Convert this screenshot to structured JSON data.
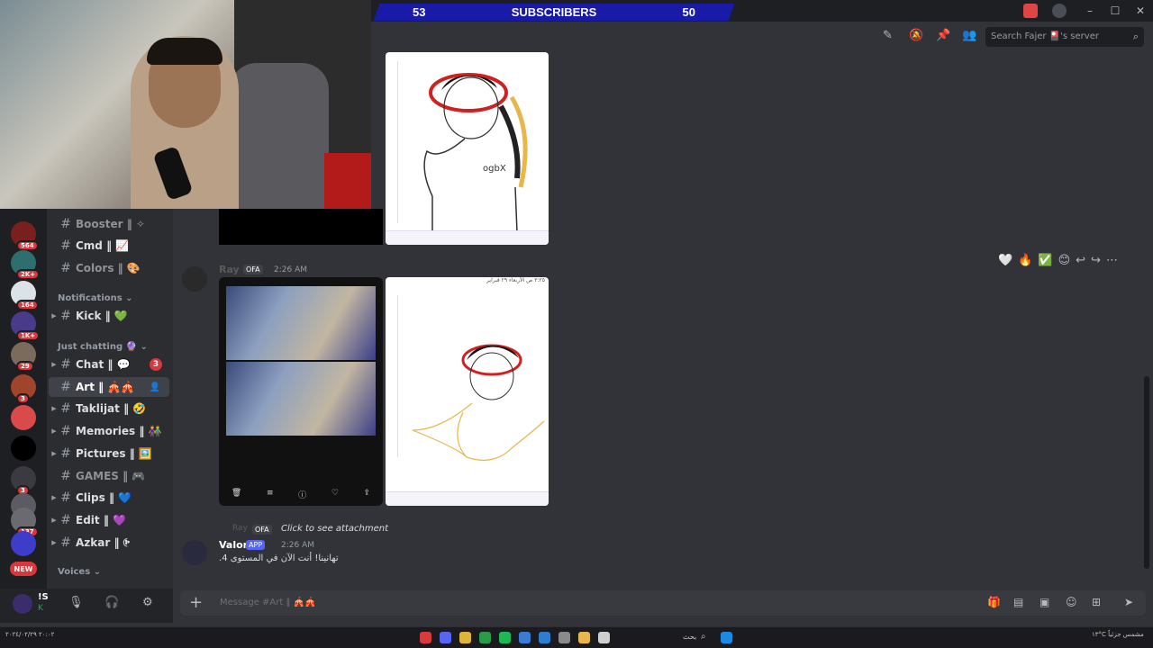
{
  "window": {
    "controls": [
      "–",
      "☐",
      "✕"
    ]
  },
  "subscribers": {
    "current": "53",
    "label": "SUBSCRIBERS",
    "goal": "50"
  },
  "servers": [
    {
      "label": "564",
      "color": "#7a1f1f"
    },
    {
      "label": "2K+",
      "color": "#2f6e6e"
    },
    {
      "label": "164",
      "color": "#dce3e8"
    },
    {
      "label": "1K+",
      "color": "#4a3a8a"
    },
    {
      "label": "29",
      "color": "#7a6b5c"
    },
    {
      "label": "3",
      "color": "#a0442c"
    },
    {
      "label": "",
      "color": "#d94a4a"
    },
    {
      "label": "",
      "color": "#000000"
    },
    {
      "label": "3",
      "color": "#3a3a40"
    },
    {
      "label": "3",
      "color": "#5b5b64"
    },
    {
      "label": "137",
      "color": "#6a6a70"
    },
    {
      "label": "",
      "color": "#3d3dc9"
    },
    {
      "label": "NEW",
      "color": "#da373c"
    }
  ],
  "sidebar": {
    "channels": [
      {
        "name": "Booster ‖ ✧",
        "muted": true
      },
      {
        "name": "Cmd ‖ 📈",
        "muted": false
      },
      {
        "name": "Colors ‖ 🎨",
        "muted": true
      },
      {
        "name": "Kick ‖ 💚",
        "muted": false
      },
      {
        "name": "Chat ‖ 💬",
        "muted": false,
        "mentions": "3"
      },
      {
        "name": "Art ‖ 🎪🎪",
        "muted": false
      },
      {
        "name": "Taklijat ‖ 🤣",
        "muted": false
      },
      {
        "name": "Memories ‖ 👫",
        "muted": false
      },
      {
        "name": "Pictures ‖ 🖼️",
        "muted": false
      },
      {
        "name": "GAMES ‖ 🎮",
        "muted": true
      },
      {
        "name": "Clips ‖ 💙",
        "muted": false
      },
      {
        "name": "Edit ‖ 💜",
        "muted": false
      },
      {
        "name": "Azkar ‖ 🤄",
        "muted": false
      }
    ],
    "categories": {
      "notifications": "Notifications ⌄",
      "just_chatting": "Just chatting 🔮 ⌄",
      "voices": "Voices ⌄"
    }
  },
  "user": {
    "name": "!S",
    "status": "K"
  },
  "header": {
    "search_placeholder": "Search Fajer 🎴's server"
  },
  "messages": [
    {
      "author": "Ray",
      "tag": "OFA",
      "time": "2:26 AM"
    },
    {
      "reply_author": "Ray",
      "reply_tag": "OFA",
      "reply_text": "Click to see attachment",
      "author": "Valor",
      "tag": "APP",
      "time": "2:26 AM",
      "text": "تهانينا! أنت الآن في المستوى 4."
    }
  ],
  "drawings": {
    "first_caption": "ogbX",
    "second_header": "٣:٢٥ ص الأربعاء ٢٩ فبراير"
  },
  "reactions": [
    "🤍",
    "🔥",
    "✅",
    "😊",
    "↩",
    "↪",
    "⋯"
  ],
  "composer": {
    "placeholder": "Message #Art ‖ 🎪🎪"
  },
  "taskbar": {
    "left_text": "٢٠:٠٢ ٢٠٢٤/٠٢/٢٩",
    "right_text": "١٣°C مشمس جزئياً",
    "search": "بحث"
  }
}
